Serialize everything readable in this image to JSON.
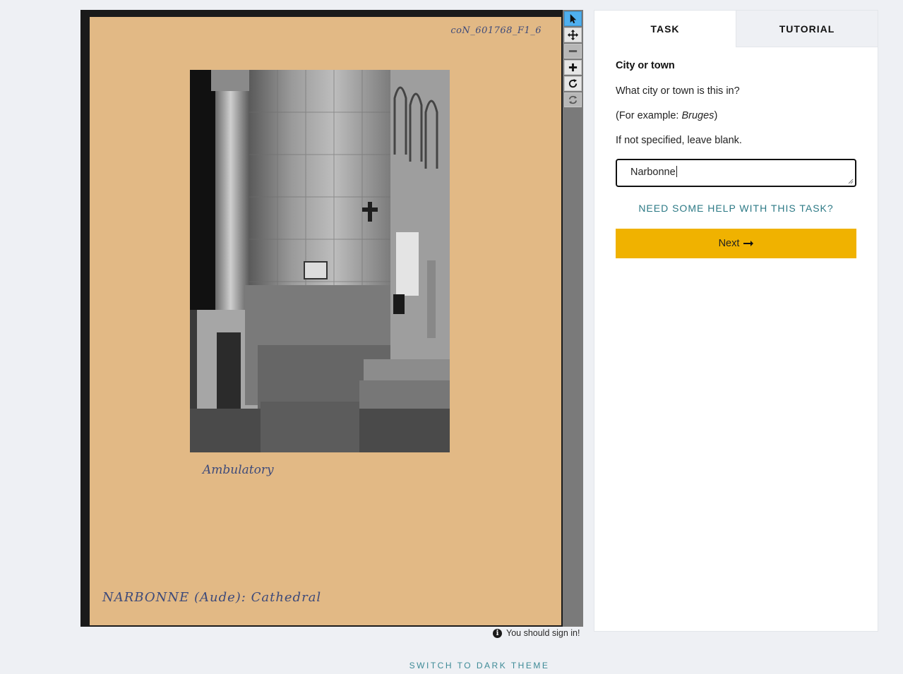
{
  "viewer": {
    "ref_number": "coN_601768_F1_6",
    "caption_ambulatory": "Ambulatory",
    "caption_main": "NARBONNE (Aude): Cathedral",
    "tools": [
      "pointer-icon",
      "move-icon",
      "zoom-out-icon",
      "zoom-in-icon",
      "rotate-icon",
      "reset-view-icon"
    ]
  },
  "signin_notice": "You should sign in!",
  "theme_toggle": "SWITCH TO DARK THEME",
  "panel": {
    "tabs": [
      {
        "label": "TASK",
        "active": true
      },
      {
        "label": "TUTORIAL",
        "active": false
      }
    ],
    "task": {
      "title": "City or town",
      "question": "What city or town is this in?",
      "example_prefix": "(For example: ",
      "example_value": "Bruges",
      "example_suffix": ")",
      "instruction": "If not specified, leave blank.",
      "answer_value": "Narbonne"
    },
    "help_link": "NEED SOME HELP WITH THIS TASK?",
    "next_button": "Next"
  },
  "colors": {
    "mount": "#e2b985",
    "next_button": "#f0b200",
    "link": "#2d7a86",
    "active_tool": "#4fb0f0"
  }
}
